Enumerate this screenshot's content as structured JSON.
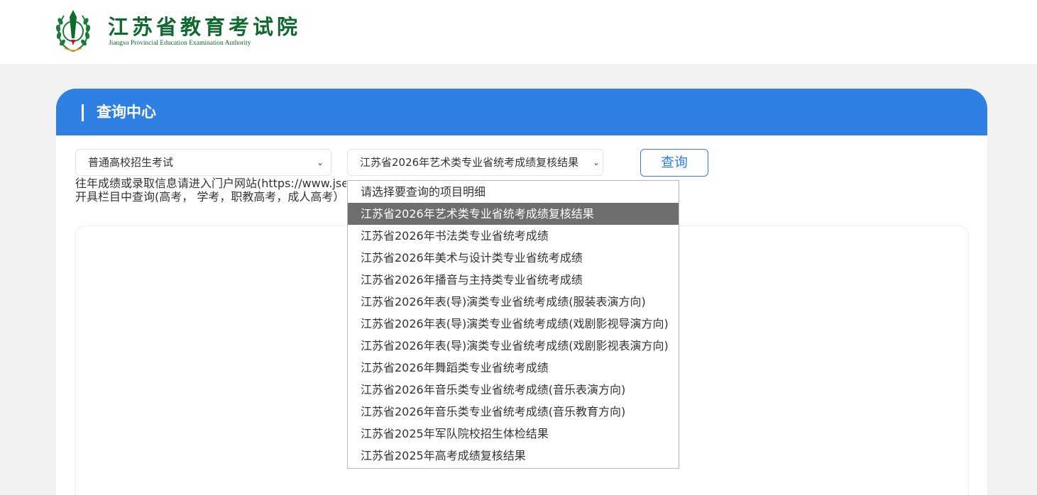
{
  "header": {
    "title": "江苏省教育考试院",
    "subtitle": "Jiangsu Provincial Education Examination Authority"
  },
  "panel": {
    "title": "查询中心"
  },
  "filters": {
    "category_value": "普通高校招生考试",
    "project_value": "江苏省2026年艺术类专业省统考成绩复核结果",
    "query_label": "查询"
  },
  "notice": {
    "line1": "往年成绩或录取信息请进入门户网站(https://www.jseea.cn)日中办事 证明",
    "line2": "开具栏目中查询(高考， 学考，职教高考，成人高考）"
  },
  "dropdown": {
    "selected_index": 1,
    "options": [
      "请选择要查询的项目明细",
      "江苏省2026年艺术类专业省统考成绩复核结果",
      "江苏省2026年书法类专业省统考成绩",
      "江苏省2026年美术与设计类专业省统考成绩",
      "江苏省2026年播音与主持类专业省统考成绩",
      "江苏省2026年表(导)演类专业省统考成绩(服装表演方向)",
      "江苏省2026年表(导)演类专业省统考成绩(戏剧影视导演方向)",
      "江苏省2026年表(导)演类专业省统考成绩(戏剧影视表演方向)",
      "江苏省2026年舞蹈类专业省统考成绩",
      "江苏省2026年音乐类专业省统考成绩(音乐表演方向)",
      "江苏省2026年音乐类专业省统考成绩(音乐教育方向)",
      "江苏省2025年军队院校招生体检结果",
      "江苏省2025年高考成绩复核结果"
    ]
  },
  "colors": {
    "brand_green": "#0e6a2e",
    "header_blue": "#2f80e3",
    "selected_gray": "#6e6e6e"
  },
  "icons": {
    "logo": "laurel-emblem-icon",
    "category_chevron": "chevron-down-icon",
    "project_chevron": "chevron-down-icon"
  }
}
